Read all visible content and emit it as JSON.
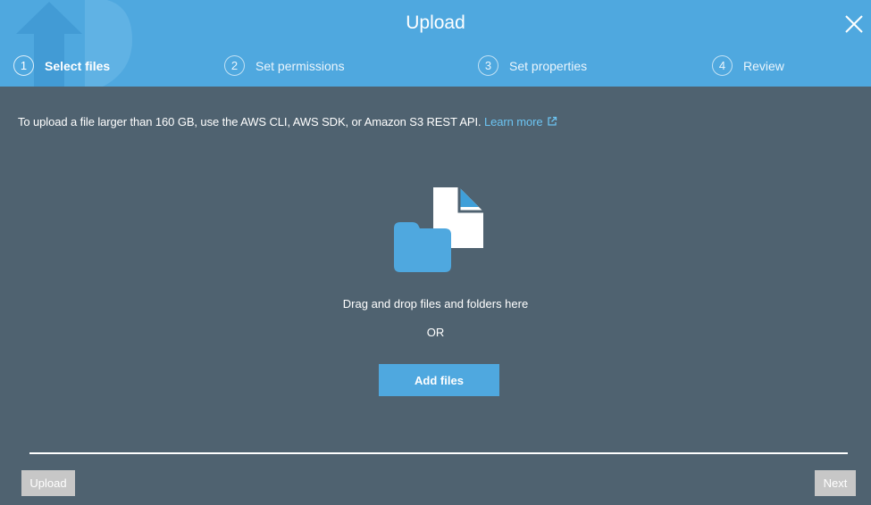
{
  "header": {
    "title": "Upload",
    "steps": [
      {
        "number": "1",
        "label": "Select files",
        "state": "active"
      },
      {
        "number": "2",
        "label": "Set permissions",
        "state": "inactive"
      },
      {
        "number": "3",
        "label": "Set properties",
        "state": "inactive"
      },
      {
        "number": "4",
        "label": "Review",
        "state": "inactive"
      }
    ],
    "close_icon": "close-icon"
  },
  "notice": {
    "text": "To upload a file larger than 160 GB, use the AWS CLI, AWS SDK, or Amazon S3 REST API.",
    "link_label": "Learn more",
    "link_icon": "external-link-icon"
  },
  "dropzone": {
    "icon": "file-and-folder-icon",
    "drag_text": "Drag and drop files and folders here",
    "or_text": "OR",
    "add_files_label": "Add files"
  },
  "footer": {
    "upload_label": "Upload",
    "next_label": "Next"
  },
  "colors": {
    "header_bg": "#4fa8df",
    "body_bg": "#4f6270",
    "link": "#6cc4f2",
    "button_primary": "#4fa8df",
    "button_disabled": "#c7c7c7"
  }
}
